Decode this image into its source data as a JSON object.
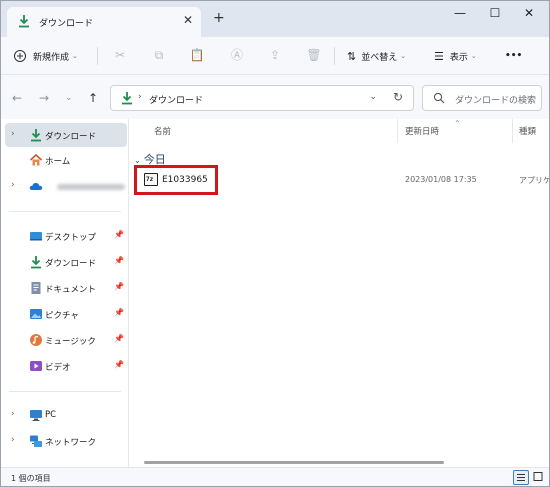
{
  "tab": {
    "title": "ダウンロード",
    "close_glyph": "✕",
    "new_glyph": "+"
  },
  "window_controls": {
    "minimize": "—",
    "maximize": "☐",
    "close": "✕"
  },
  "toolbar": {
    "new_label": "新規作成",
    "sort_label": "並べ替え",
    "view_label": "表示",
    "more_label": "•••"
  },
  "address": {
    "path": "ダウンロード",
    "search_placeholder": "ダウンロードの検索"
  },
  "sidebar": {
    "top": [
      {
        "label": "ダウンロード",
        "icon": "download-icon"
      },
      {
        "label": "ホーム",
        "icon": "home-icon"
      },
      {
        "label": "",
        "icon": "onedrive-icon"
      }
    ],
    "quick": [
      {
        "label": "デスクトップ",
        "icon": "desktop-icon"
      },
      {
        "label": "ダウンロード",
        "icon": "download-icon"
      },
      {
        "label": "ドキュメント",
        "icon": "document-icon"
      },
      {
        "label": "ピクチャ",
        "icon": "pictures-icon"
      },
      {
        "label": "ミュージック",
        "icon": "music-icon"
      },
      {
        "label": "ビデオ",
        "icon": "video-icon"
      }
    ],
    "bottom": [
      {
        "label": "PC",
        "icon": "pc-icon"
      },
      {
        "label": "ネットワーク",
        "icon": "network-icon"
      }
    ]
  },
  "columns": {
    "name": "名前",
    "date": "更新日時",
    "type": "種類"
  },
  "group": "今日",
  "files": [
    {
      "name": "E1033965",
      "date": "2023/01/08 17:35",
      "type": "アプリケ",
      "icon_text": "7z"
    }
  ],
  "status": {
    "count_text": "1 個の項目"
  },
  "colors": {
    "accent": "#1d8f4e",
    "highlight": "#d2171c",
    "selected": "#dbe2ea"
  }
}
